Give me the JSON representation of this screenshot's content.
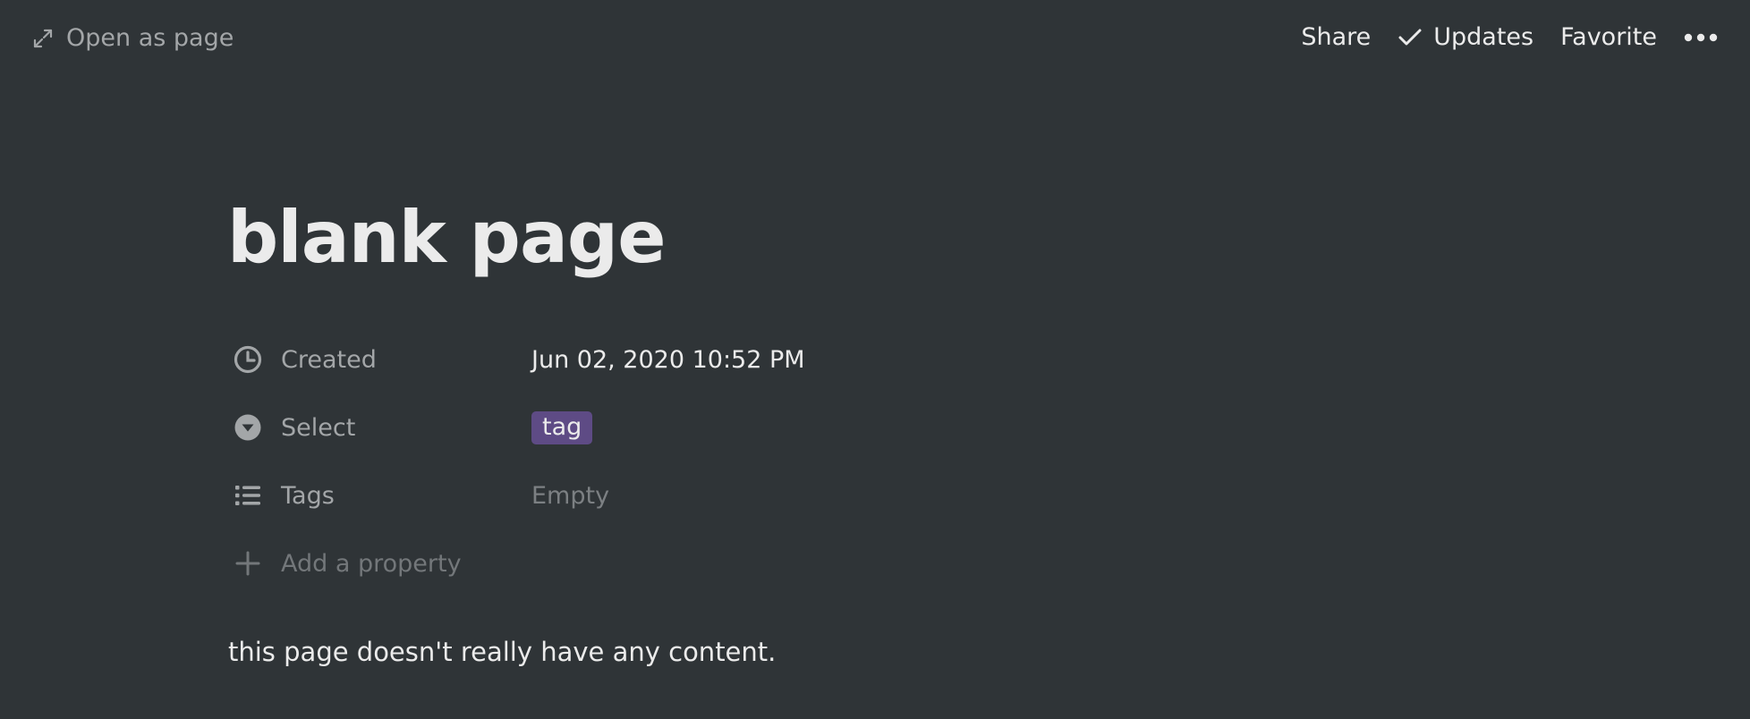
{
  "topbar": {
    "open_as_page_label": "Open as page",
    "share_label": "Share",
    "updates_label": "Updates",
    "favorite_label": "Favorite",
    "more_icon": "more-horizontal-icon"
  },
  "page": {
    "title": "blank page",
    "body_text": "this page doesn't really have any content."
  },
  "properties": [
    {
      "name": "Created",
      "icon": "clock-icon",
      "value": "Jun 02, 2020 10:52 PM"
    },
    {
      "name": "Select",
      "icon": "select-icon",
      "value": "tag",
      "chip_color": "#5e4b85"
    },
    {
      "name": "Tags",
      "icon": "list-icon",
      "value": "Empty"
    }
  ],
  "add_property_label": "Add a property",
  "colors": {
    "background": "#2f3437",
    "text": "#ebebeb",
    "muted": "#a3a6a8",
    "tag_chip": "#5e4b85"
  }
}
